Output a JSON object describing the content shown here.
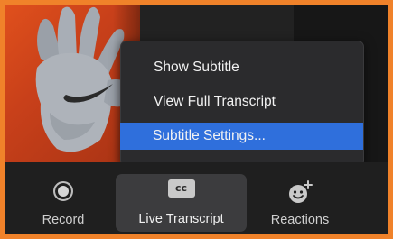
{
  "menu": {
    "items": [
      {
        "label": "Show Subtitle"
      },
      {
        "label": "View Full Transcript"
      },
      {
        "label": "Subtitle Settings..."
      }
    ],
    "selected_index": 2
  },
  "toolbar": {
    "record_label": "Record",
    "live_transcript_label": "Live Transcript",
    "cc_text": "cc",
    "reactions_label": "Reactions"
  },
  "icons": {
    "record": "record-icon",
    "cc": "closed-captions-icon",
    "reactions": "smiley-plus-icon"
  },
  "colors": {
    "accent_border": "#f0822a",
    "menu_selected": "#2f6fdc",
    "menu_bg": "#2b2b2d",
    "toolbar_bg": "#1f1f1f"
  }
}
